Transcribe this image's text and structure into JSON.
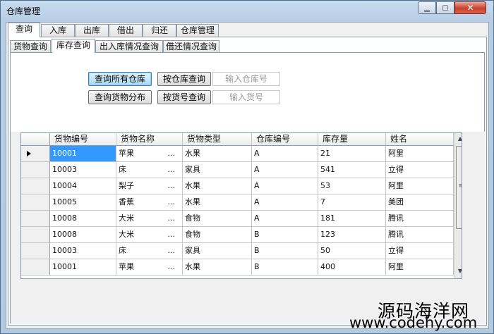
{
  "window": {
    "title": "仓库管理",
    "minimize_label": "▁",
    "maximize_label": "▢",
    "close_label": "✕"
  },
  "main_tabs": [
    "查询",
    "入库",
    "出库",
    "借出",
    "归还",
    "仓库管理"
  ],
  "sub_tabs": [
    "货物查询",
    "库存查询",
    "出入库情况查询",
    "借还情况查询"
  ],
  "query": {
    "query_all_warehouses": "查询所有仓库",
    "query_by_warehouse": "按仓库查询",
    "warehouse_input_placeholder": "输入仓库号",
    "query_goods_distribution": "查询货物分布",
    "query_by_goods_id": "按货号查询",
    "goods_input_placeholder": "输入货号"
  },
  "grid": {
    "columns": [
      "货物编号",
      "货物名称",
      "货物类型",
      "仓库编号",
      "库存量",
      "姓名"
    ],
    "rows": [
      [
        "10001",
        "苹果",
        "水果",
        "A",
        "21",
        "阿里"
      ],
      [
        "10003",
        "床",
        "家具",
        "A",
        "541",
        "立得"
      ],
      [
        "10004",
        "梨子",
        "水果",
        "A",
        "53",
        "阿里"
      ],
      [
        "10005",
        "香蕉",
        "水果",
        "A",
        "7",
        "美团"
      ],
      [
        "10008",
        "大米",
        "食物",
        "A",
        "181",
        "腾讯"
      ],
      [
        "10008",
        "大米",
        "食物",
        "B",
        "123",
        "腾讯"
      ],
      [
        "10003",
        "床",
        "家具",
        "B",
        "50",
        "立得"
      ],
      [
        "10001",
        "苹果",
        "水果",
        "B",
        "400",
        "阿里"
      ]
    ],
    "ellipsis": "...",
    "scroll_up": "▲",
    "scroll_down": "▼",
    "grip": "≡"
  },
  "watermark": {
    "line1": "源码海洋网",
    "line2": "www.codehy.com"
  },
  "colors": {
    "selection": "#3399ff",
    "title_bar": "#b7cde4",
    "close_button": "#c9412c"
  }
}
